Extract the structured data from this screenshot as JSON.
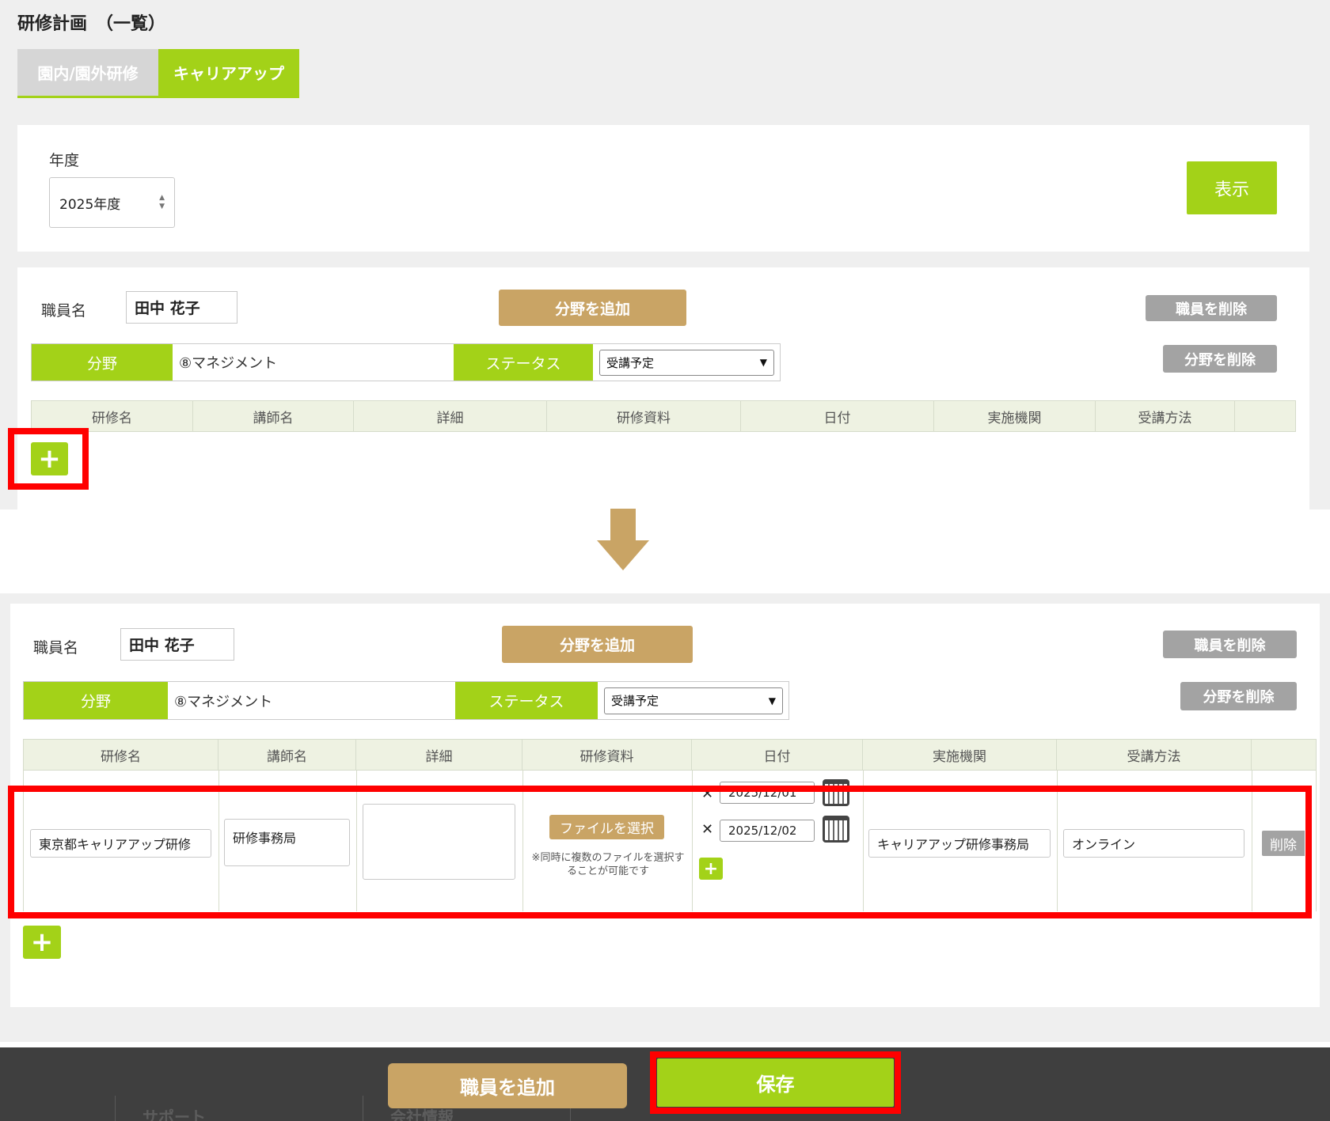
{
  "page": {
    "title": "研修計画　（一覧）"
  },
  "tabs": [
    {
      "label": "園内/園外研修"
    },
    {
      "label": "キャリアアップ"
    }
  ],
  "filter": {
    "year_label": "年度",
    "year_value": "2025年度",
    "display_button": "表示"
  },
  "staff": {
    "name_label": "職員名",
    "name_value": "田中 花子",
    "add_field_button": "分野を追加",
    "delete_staff_button": "職員を削除",
    "delete_field_button": "分野を削除",
    "field_label": "分野",
    "field_value": "⑧マネジメント",
    "status_label": "ステータス",
    "status_value": "受講予定"
  },
  "table": {
    "headers": [
      "研修名",
      "講師名",
      "詳細",
      "研修資料",
      "日付",
      "実施機関",
      "受講方法"
    ]
  },
  "row": {
    "training_name": "東京都キャリアアップ研修",
    "instructor": "研修事務局",
    "file_button": "ファイルを選択",
    "file_note": "※同時に複数のファイルを選択することが可能です",
    "date1": "2025/12/01",
    "date2": "2025/12/02",
    "institution": "キャリアアップ研修事務局",
    "method": "オンライン",
    "delete_button": "削除"
  },
  "footer": {
    "add_staff_button": "職員を追加",
    "save_button": "保存",
    "link_support": "サポート",
    "link_company": "会社情報"
  },
  "icons": {
    "plus": "+",
    "close": "✕",
    "chevron": "⌄"
  },
  "colors": {
    "green": "#a3d218",
    "tan": "#c9a465",
    "gray": "#a3a3a3",
    "highlight_red": "#ff0000",
    "footer_dark": "#3f3f3f"
  }
}
